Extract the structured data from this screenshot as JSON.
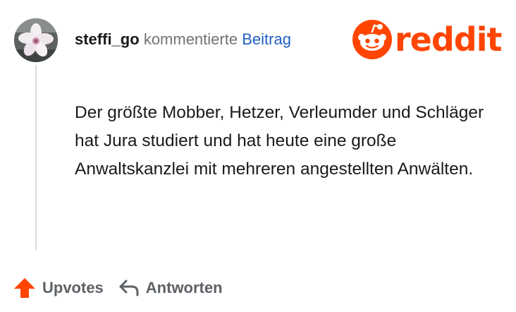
{
  "comment": {
    "username": "steffi_go",
    "action_text": "kommentierte",
    "target_link": "Beitrag",
    "body": "Der größte Mobber, Hetzer, Verleumder und Schläger hat Jura studiert und hat heute eine große Anwaltskanzlei mit mehreren angestellten Anwälten."
  },
  "brand": {
    "wordmark": "reddit",
    "color": "#ff4500",
    "icon": "reddit-snoo-icon"
  },
  "actions": {
    "upvote_label": "Upvotes",
    "upvote_icon": "upvote-arrow-icon",
    "upvote_color": "#ff4500",
    "reply_label": "Antworten",
    "reply_icon": "reply-arrow-icon"
  },
  "avatar": {
    "icon": "flower-avatar"
  }
}
